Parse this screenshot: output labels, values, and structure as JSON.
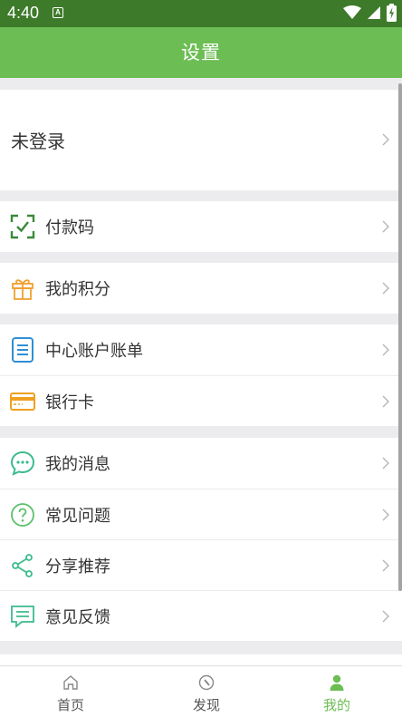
{
  "status_bar": {
    "time": "4:40",
    "notification_badge": "A"
  },
  "header": {
    "title": "设置"
  },
  "login": {
    "label": "未登录"
  },
  "menu": {
    "payment_code": "付款码",
    "points": "我的积分",
    "center_bill": "中心账户账单",
    "bank_card": "银行卡",
    "messages": "我的消息",
    "faq": "常见问题",
    "share": "分享推荐",
    "feedback": "意见反馈"
  },
  "tabbar": {
    "items": [
      {
        "label": "首页",
        "icon": "home-icon"
      },
      {
        "label": "发现",
        "icon": "compass-icon"
      },
      {
        "label": "我的",
        "icon": "person-icon"
      }
    ],
    "active_index": 2
  },
  "colors": {
    "status_bar": "#3d7a2a",
    "header": "#6cbd53",
    "accent": "#6cbd53",
    "payment_icon": "#3a8a3a",
    "points_icon": "#f0a030",
    "bill_icon": "#2f8fd6",
    "bank_icon": "#f0a020",
    "teal_icons": "#3dbb8c"
  }
}
